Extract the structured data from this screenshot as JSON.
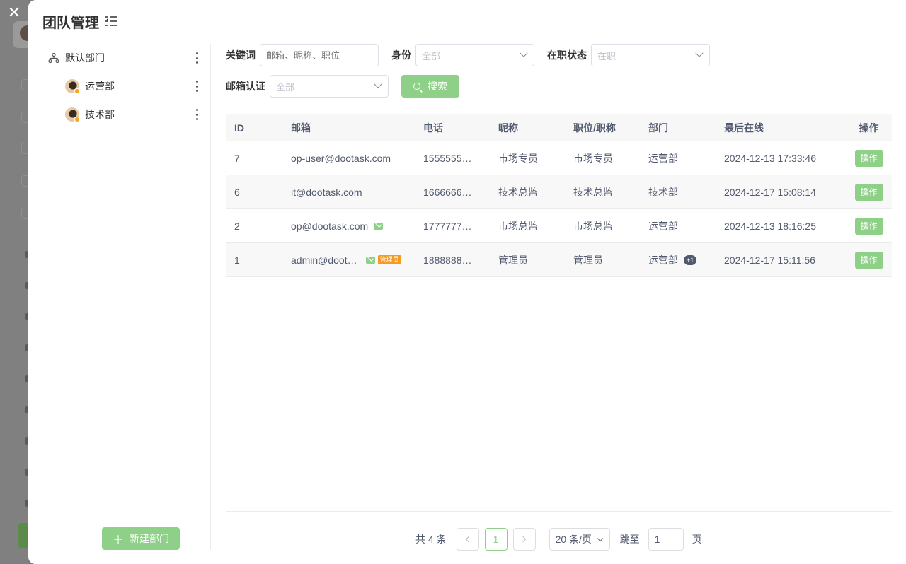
{
  "drawer": {
    "title": "团队管理",
    "close_icon": "✕"
  },
  "departments": {
    "items": [
      {
        "label": "默认部门",
        "icon": "tree-icon"
      },
      {
        "label": "运营部",
        "icon": "avatar"
      },
      {
        "label": "技术部",
        "icon": "avatar"
      }
    ],
    "new_button": "新建部门",
    "new_button_icon": "＋"
  },
  "filters": {
    "keyword": {
      "label": "关键词",
      "placeholder": "邮箱、昵称、职位"
    },
    "identity": {
      "label": "身份",
      "value": "全部"
    },
    "status": {
      "label": "在职状态",
      "value": "在职"
    },
    "email_verify": {
      "label": "邮箱认证",
      "value": "全部"
    },
    "search_button": "搜索"
  },
  "table": {
    "headers": {
      "id": "ID",
      "email": "邮箱",
      "phone": "电话",
      "nickname": "昵称",
      "position": "职位/职称",
      "department": "部门",
      "last_online": "最后在线",
      "action": "操作"
    },
    "rows": [
      {
        "id": "7",
        "email": "op-user@dootask.com",
        "verified": false,
        "admin": false,
        "phone": "1555555…",
        "nickname": "市场专员",
        "position": "市场专员",
        "department": "运营部",
        "dept_extra": "",
        "last_online": "2024-12-13 17:33:46",
        "action": "操作"
      },
      {
        "id": "6",
        "email": "it@dootask.com",
        "verified": false,
        "admin": false,
        "phone": "1666666…",
        "nickname": "技术总监",
        "position": "技术总监",
        "department": "技术部",
        "dept_extra": "",
        "last_online": "2024-12-17 15:08:14",
        "action": "操作"
      },
      {
        "id": "2",
        "email": "op@dootask.com",
        "verified": true,
        "admin": false,
        "phone": "1777777…",
        "nickname": "市场总监",
        "position": "市场总监",
        "department": "运营部",
        "dept_extra": "",
        "last_online": "2024-12-13 18:16:25",
        "action": "操作"
      },
      {
        "id": "1",
        "email": "admin@doot…",
        "verified": true,
        "admin": true,
        "admin_label": "管理员",
        "phone": "1888888…",
        "nickname": "管理员",
        "position": "管理员",
        "department": "运营部",
        "dept_extra": "+1",
        "last_online": "2024-12-17 15:11:56",
        "action": "操作"
      }
    ]
  },
  "pagination": {
    "total": "共 4 条",
    "current_page": "1",
    "page_size": "20 条/页",
    "jump_label": "跳至",
    "jump_value": "1",
    "page_unit": "页"
  },
  "colors": {
    "accent": "#8fd088",
    "admin_badge": "#f59a23"
  }
}
